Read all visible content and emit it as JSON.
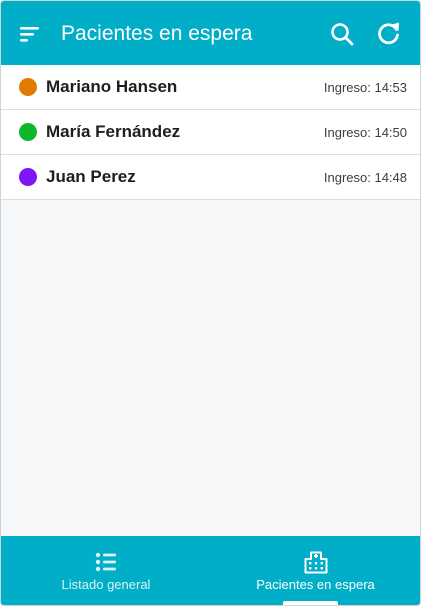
{
  "colors": {
    "accent": "#00aec7",
    "background": "#f6f7f8",
    "row_background": "#ffffff"
  },
  "appbar": {
    "title": "Pacientes en espera",
    "menu_icon": "sort-menu-icon",
    "search_icon": "search-icon",
    "refresh_icon": "refresh-icon"
  },
  "patients": [
    {
      "name": "Mariano Hansen",
      "admission": "Ingreso: 14:53",
      "status_color": "#e07b00"
    },
    {
      "name": "María Fernández",
      "admission": "Ingreso: 14:50",
      "status_color": "#0fb52a"
    },
    {
      "name": "Juan Perez",
      "admission": "Ingreso: 14:48",
      "status_color": "#7f16f5"
    }
  ],
  "bottom_nav": {
    "items": [
      {
        "label": "Listado general",
        "icon": "list-icon",
        "active": false
      },
      {
        "label": "Pacientes en espera",
        "icon": "hospital-icon",
        "active": true
      }
    ]
  }
}
